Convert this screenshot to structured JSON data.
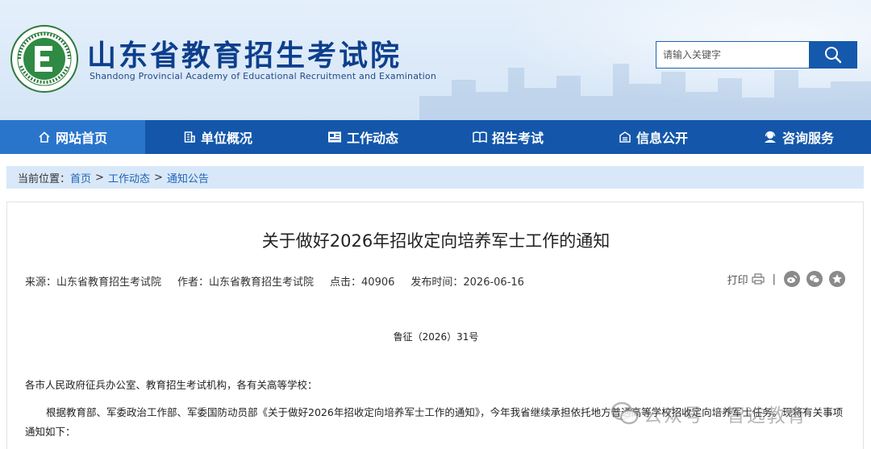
{
  "header": {
    "logo_ring_text": "Shandong Educational Admission & Examination",
    "logo_letter": "E",
    "site_title": "山东省教育招生考试院",
    "site_subtitle": "Shandong Provincial Academy of Educational Recruitment and Examination",
    "search_placeholder": "请输入关键字"
  },
  "nav": {
    "items": [
      {
        "label": "网站首页",
        "icon": "home-icon",
        "active": true
      },
      {
        "label": "单位概况",
        "icon": "building-icon",
        "active": false
      },
      {
        "label": "工作动态",
        "icon": "news-icon",
        "active": false
      },
      {
        "label": "招生考试",
        "icon": "book-icon",
        "active": false
      },
      {
        "label": "信息公开",
        "icon": "info-icon",
        "active": false
      },
      {
        "label": "咨询服务",
        "icon": "user-service-icon",
        "active": false
      }
    ]
  },
  "breadcrumb": {
    "prefix": "当前位置：",
    "items": [
      "首页",
      "工作动态",
      "通知公告"
    ],
    "separator": ">"
  },
  "article": {
    "title": "关于做好2026年招收定向培养军士工作的通知",
    "meta": {
      "source": "来源：山东省教育招生考试院",
      "author": "作者：山东省教育招生考试院",
      "clicks": "点击：40906",
      "date": "发布时间：2026-06-16"
    },
    "print_label": "打印",
    "divider": "|",
    "share_icons": [
      "weibo-icon",
      "wechat-icon",
      "qzone-icon"
    ],
    "doc_number": "鲁征（2026）31号",
    "paragraphs": [
      "各市人民政府征兵办公室、教育招生考试机构，各有关高等学校：",
      "根据教育部、军委政治工作部、军委国防动员部《关于做好2026年招收定向培养军士工作的通知》，今年我省继续承担依托地方普通高等学校招收定向培养军士任务。现将有关事项通知如下："
    ]
  },
  "watermark": {
    "text": "公众号 · 智选教育"
  },
  "colors": {
    "brand_blue": "#1457aa",
    "nav_active": "#2a75cc",
    "title_blue": "#0d3f8c",
    "breadcrumb_bg": "#d8e8f8"
  }
}
